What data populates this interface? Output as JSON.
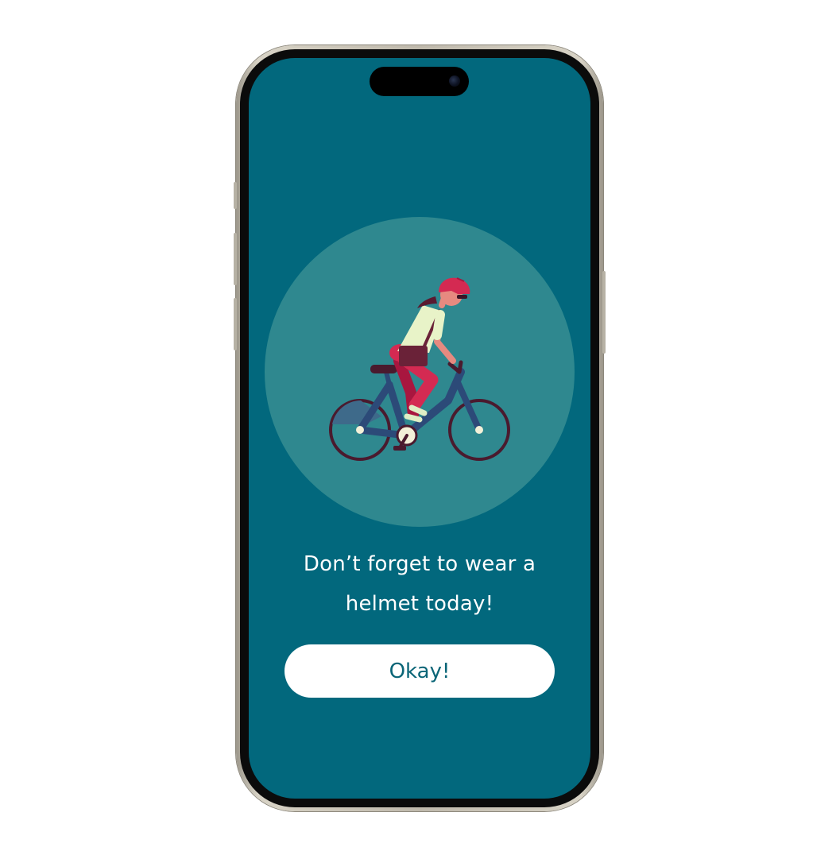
{
  "screen": {
    "background_color": "#02687d",
    "circle_color": "#2f888f"
  },
  "illustration": {
    "name": "cyclist-with-helmet"
  },
  "message": {
    "line1": "Don’t forget to wear a",
    "line2": "helmet today!"
  },
  "actions": {
    "ok_label": "Okay!"
  }
}
